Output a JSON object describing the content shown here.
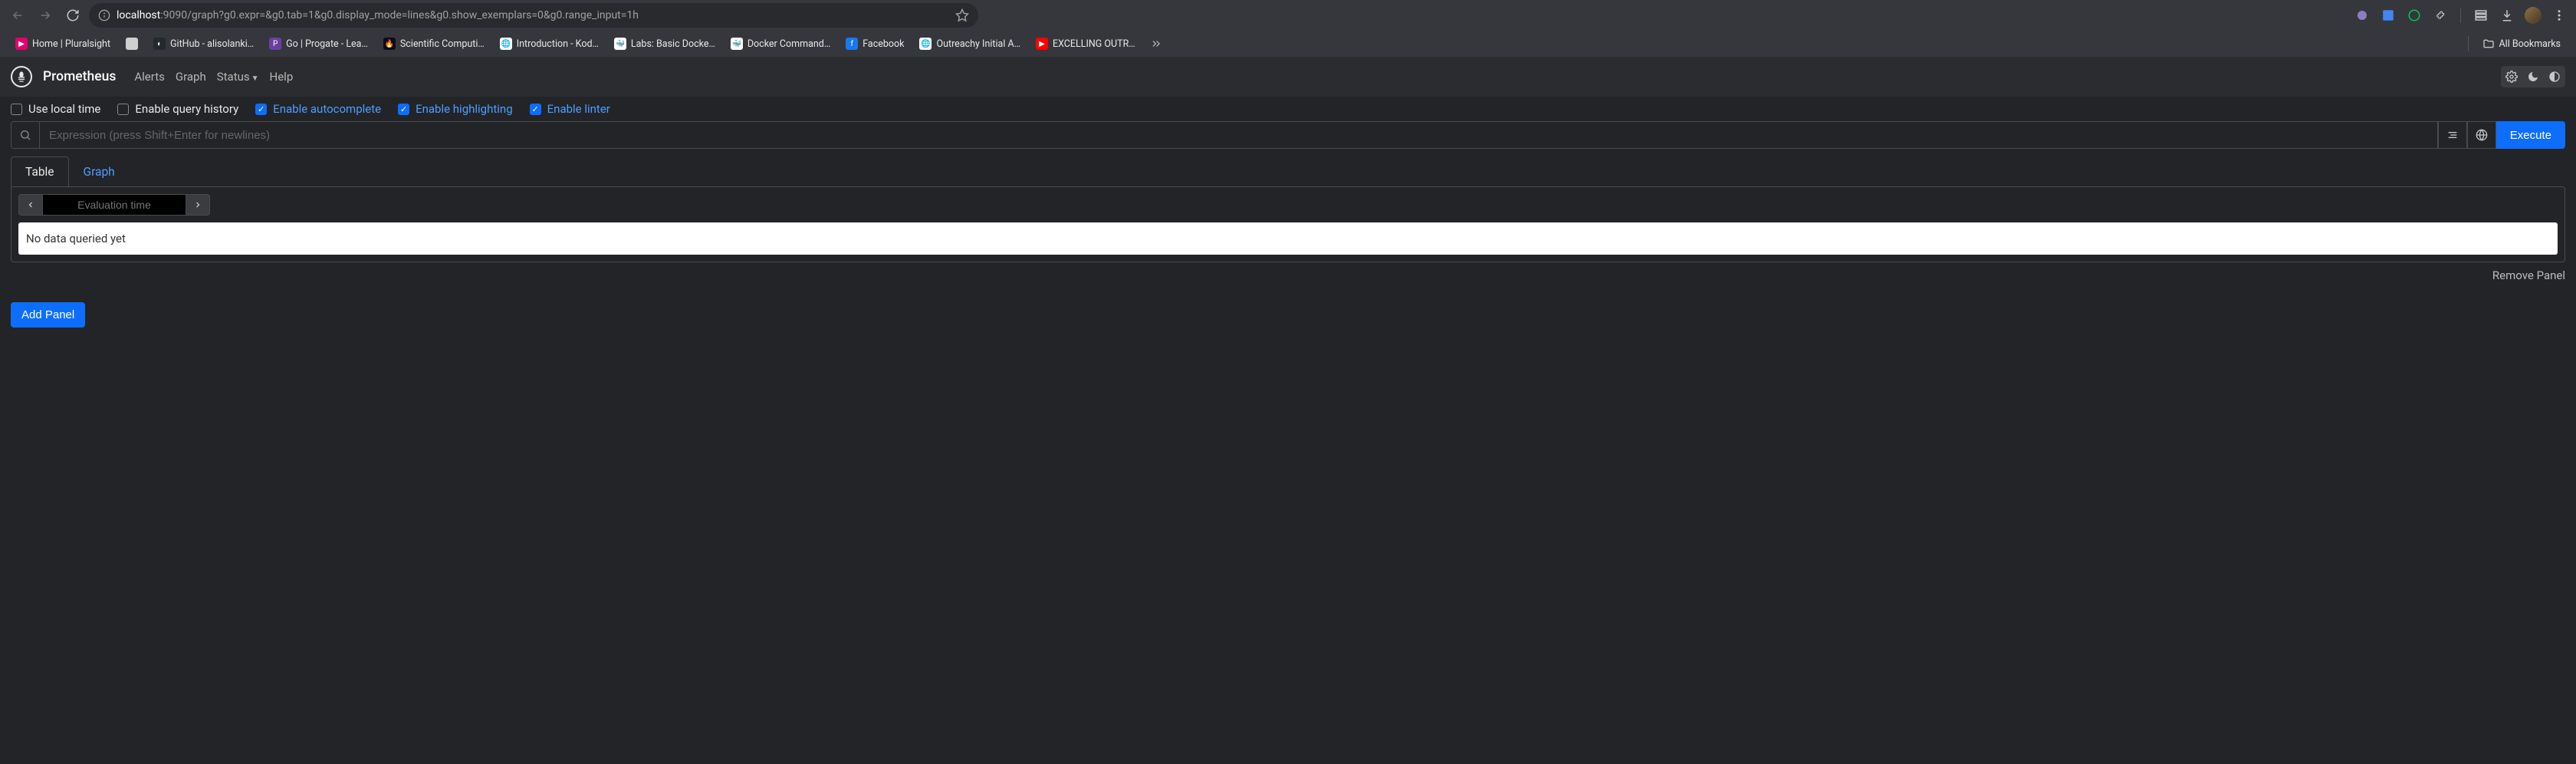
{
  "browser": {
    "url_host": "localhost",
    "url_rest": ":9090/graph?g0.expr=&g0.tab=1&g0.display_mode=lines&g0.show_exemplars=0&g0.range_input=1h"
  },
  "bookmarks": {
    "items": [
      {
        "label": "Home | Pluralsight",
        "favicon_bg": "#e5006d",
        "glyph": "▶"
      },
      {
        "label": "",
        "favicon_bg": "#cfcfcf",
        "glyph": ""
      },
      {
        "label": "GitHub - alisolanki…",
        "favicon_bg": "#24292e",
        "glyph": "◐"
      },
      {
        "label": "Go | Progate - Lea…",
        "favicon_bg": "#6b3fa0",
        "glyph": "P"
      },
      {
        "label": "Scientific Computi…",
        "favicon_bg": "#0a0a23",
        "glyph": "🔥"
      },
      {
        "label": "Introduction - Kod…",
        "favicon_bg": "#ffffff",
        "glyph": "🌐"
      },
      {
        "label": "Labs: Basic Docke…",
        "favicon_bg": "#ffffff",
        "glyph": "🐳"
      },
      {
        "label": "Docker Command…",
        "favicon_bg": "#ffffff",
        "glyph": "🐳"
      },
      {
        "label": "Facebook",
        "favicon_bg": "#1877f2",
        "glyph": "f"
      },
      {
        "label": "Outreachy Initial A…",
        "favicon_bg": "#ffffff",
        "glyph": "🌐"
      },
      {
        "label": "EXCELLING OUTR…",
        "favicon_bg": "#ff0000",
        "glyph": "▶"
      }
    ],
    "all": "All Bookmarks"
  },
  "navbar": {
    "brand": "Prometheus",
    "links": {
      "alerts": "Alerts",
      "graph": "Graph",
      "status": "Status",
      "help": "Help"
    }
  },
  "options": {
    "use_local_time": "Use local time",
    "enable_query_history": "Enable query history",
    "enable_autocomplete": "Enable autocomplete",
    "enable_highlighting": "Enable highlighting",
    "enable_linter": "Enable linter"
  },
  "query": {
    "placeholder": "Expression (press Shift+Enter for newlines)",
    "execute": "Execute"
  },
  "tabs": {
    "table": "Table",
    "graph": "Graph"
  },
  "panel": {
    "eval_placeholder": "Evaluation time",
    "no_data": "No data queried yet",
    "remove": "Remove Panel",
    "add": "Add Panel"
  }
}
